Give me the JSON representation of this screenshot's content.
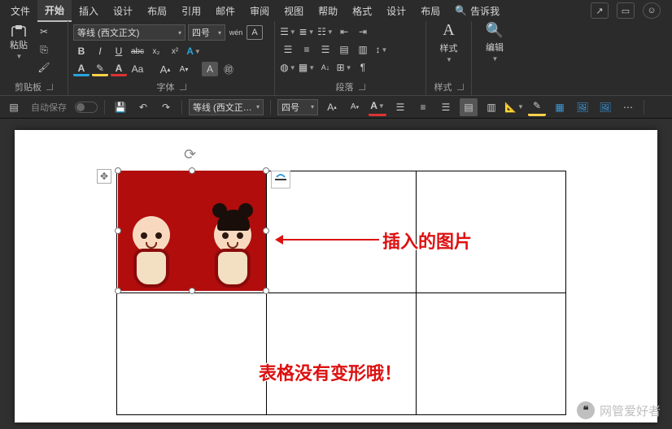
{
  "menu": {
    "items": [
      "文件",
      "开始",
      "插入",
      "设计",
      "布局",
      "引用",
      "邮件",
      "审阅",
      "视图",
      "帮助",
      "格式",
      "设计",
      "布局"
    ],
    "active_index": 1,
    "tell_me_icon": "search",
    "tell_me": "告诉我"
  },
  "titlebar": {
    "share": "↗",
    "comments": "▭",
    "account": "☺"
  },
  "ribbon": {
    "clipboard": {
      "label": "剪贴板",
      "paste": "粘贴",
      "cut": "scissors",
      "copy": "copy",
      "format_painter": "brush"
    },
    "font": {
      "label": "字体",
      "face": "等线 (西文正文)",
      "size": "四号",
      "pinyin": "wén",
      "char_border": "A",
      "buttons_row2": [
        "B",
        "I",
        "U",
        "abc",
        "x₂",
        "x²"
      ],
      "buttons_row3_colors": [
        "#2aa3da",
        "#ffd24a",
        "#d33",
        "#bbb"
      ],
      "case": "Aa",
      "clear": "Aᵪ"
    },
    "paragraph": {
      "label": "段落",
      "bullets": "list",
      "numbers": "numlist",
      "multilevel": "multilist",
      "indent_dec": "⇤",
      "indent_inc": "⇥",
      "align": [
        "left",
        "center",
        "right",
        "justify"
      ],
      "line_spacing": "↕",
      "shading": "▭",
      "borders": "▦",
      "sort": "A↓",
      "show_marks": "¶"
    },
    "styles": {
      "label": "样式",
      "button": "样式",
      "glyph": "A"
    },
    "editing": {
      "label": "编辑",
      "glyph": "🔍"
    }
  },
  "qat": {
    "autosave_label": "自动保存",
    "save_color": "#d763e8",
    "undo": "↶",
    "redo": "↷",
    "font_face": "等线 (西文正…",
    "font_size": "四号",
    "grow": "A↑",
    "shrink": "A↓",
    "font_color": "A",
    "align": [
      "left",
      "center",
      "right",
      "justify-active",
      "dist"
    ],
    "ruler": "📏",
    "ink": "✎",
    "table": "▦",
    "pic1": "🖼",
    "pic2": "🖼",
    "more": "⋯"
  },
  "doc": {
    "rotate_icon": "⟳",
    "anchor_icon": "✥",
    "callout1": "插入的图片",
    "callout2": "表格没有变形哦！"
  },
  "watermark": {
    "text": "网管爱好者"
  }
}
